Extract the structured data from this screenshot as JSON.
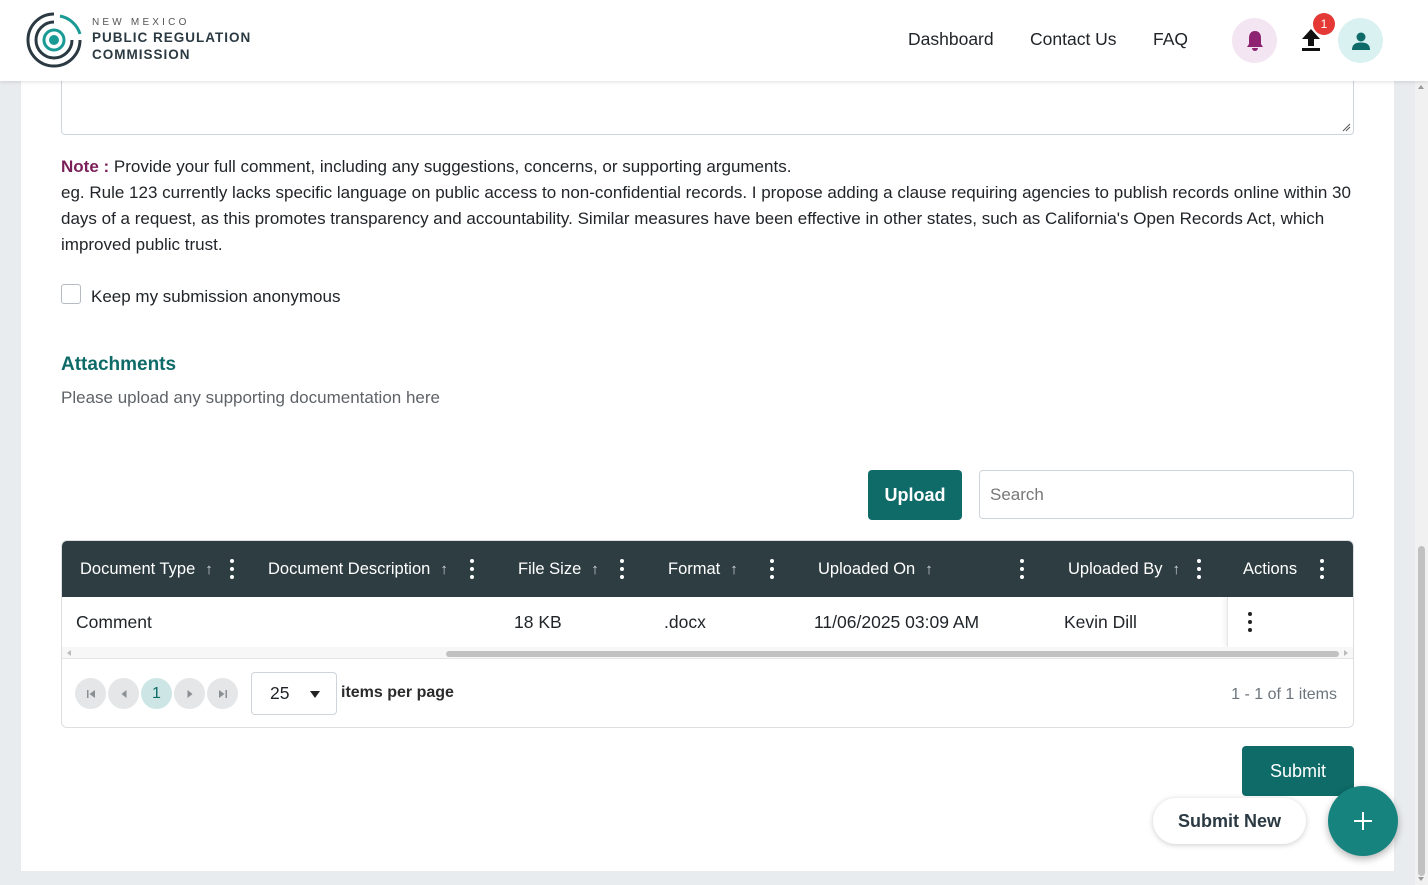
{
  "header": {
    "logo_top": "NEW MEXICO",
    "logo_line1": "PUBLIC REGULATION",
    "logo_line2": "COMMISSION",
    "nav": [
      "Dashboard",
      "Contact Us",
      "FAQ"
    ],
    "upload_badge": "1",
    "colors": {
      "bell_bg": "#f3e5f1",
      "bell": "#8e2471",
      "avatar_bg": "#d9f1f0",
      "avatar": "#0e6b68"
    }
  },
  "form": {
    "note_label": "Note :",
    "note_text": " Provide your full comment, including any suggestions, concerns, or supporting arguments.",
    "example_text": "eg. Rule 123 currently lacks specific language on public access to non-confidential records. I propose adding a clause requiring agencies to publish records online within 30 days of a request, as this promotes transparency and accountability. Similar measures have been effective in other states, such as California's Open Records Act, which improved public trust.",
    "anonymous_label": "Keep my submission anonymous",
    "anonymous_checked": false
  },
  "attachments": {
    "title": "Attachments",
    "description": "Please upload any supporting documentation here",
    "upload_label": "Upload",
    "search_placeholder": "Search",
    "columns": [
      "Document Type",
      "Document Description",
      "File Size",
      "Format",
      "Uploaded On",
      "Uploaded By",
      "Actions"
    ],
    "rows": [
      {
        "document_type": "Comment",
        "document_description": "",
        "file_size": "18 KB",
        "format": ".docx",
        "uploaded_on": "11/06/2025 03:09 AM",
        "uploaded_by": "Kevin Dill"
      }
    ],
    "pager": {
      "current_page": "1",
      "page_size": "25",
      "items_per_page_label": "items per page",
      "info": "1 - 1 of 1 items"
    }
  },
  "actions": {
    "submit_label": "Submit",
    "submit_new_label": "Submit New"
  },
  "colors": {
    "primary": "#0e6b68",
    "table_header": "#2e3d42",
    "note_label": "#7b1f5a",
    "badge": "#e53935"
  }
}
